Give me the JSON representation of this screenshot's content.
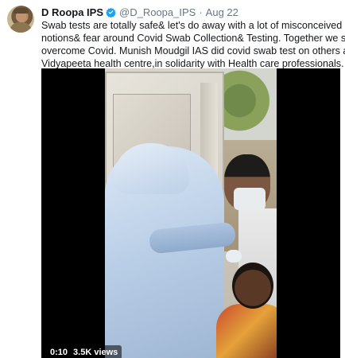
{
  "tweet": {
    "author_name": "D Roopa IPS",
    "handle": "@D_Roopa_IPS",
    "separator": "·",
    "date": "Aug 22",
    "text_lines": [
      "Swab tests are totally safe& let's do away with a lot of misconceived",
      "notions& fear around Covid Swab Collection& Testing. Together we shall",
      "overcome Covid. Munish Moudgil IAS did covid swab test on others at",
      "Vidyapeeta health centre,in solidarity with Health care professionals."
    ]
  },
  "video": {
    "elapsed": "0:10",
    "views": "3.5K views"
  },
  "colors": {
    "text_primary": "#14171a",
    "text_secondary": "#657786",
    "verified_badge": "#1da1f2",
    "video_background": "#000000"
  },
  "icons": {
    "verified": "verified-badge-icon"
  }
}
